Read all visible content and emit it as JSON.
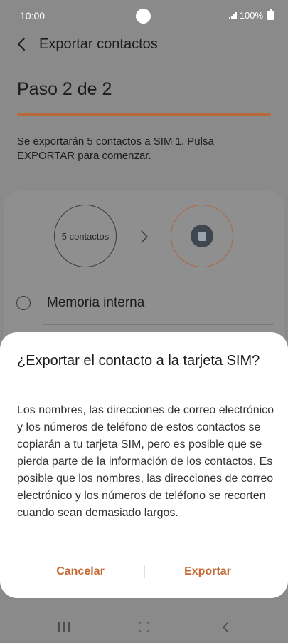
{
  "status_bar": {
    "time": "10:00",
    "battery": "100%"
  },
  "header": {
    "title": "Exportar contactos"
  },
  "step": {
    "title": "Paso 2 de 2",
    "progress": 1.0
  },
  "info": {
    "text": "Se exportarán 5 contactos a SIM 1. Pulsa EXPORTAR para comenzar."
  },
  "flow": {
    "source_label": "5 contactos"
  },
  "storage": {
    "option_label": "Memoria interna"
  },
  "dialog": {
    "title": "¿Exportar el contacto a la tarjeta SIM?",
    "body": "Los nombres, las direcciones de correo electrónico y los números de teléfono de estos contactos se copiarán a tu tarjeta SIM, pero es posible que se pierda parte de la información de los contactos. Es posible que los nombres, las direcciones de correo electrónico y los números de teléfono se recorten cuando sean demasiado largos.",
    "cancel_label": "Cancelar",
    "export_label": "Exportar"
  },
  "colors": {
    "accent": "#c46a35",
    "scrim": "#8a8a8a",
    "dialog_bg": "#ffffff"
  },
  "icons": [
    "back-icon",
    "chevron-right-icon",
    "sim-card-icon",
    "radio-icon",
    "recent-apps-icon",
    "home-icon",
    "nav-back-icon",
    "signal-icon",
    "battery-icon"
  ]
}
